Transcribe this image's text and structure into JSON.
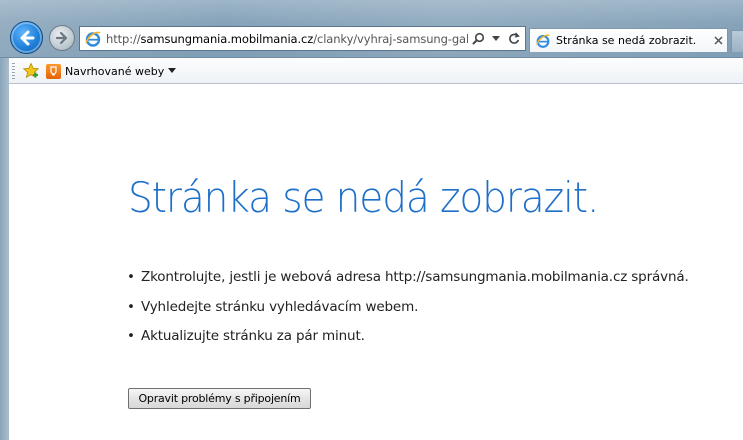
{
  "browser": {
    "address_url_prefix": "http://",
    "address_url_domain": "samsungmania.mobilmania.cz",
    "address_url_path": "/clanky/vyhraj-samsung-galaxy",
    "tab_title": "Stránka se nedá zobrazit.",
    "favorites": {
      "suggested_sites_label": "Navrhované weby"
    }
  },
  "error_page": {
    "title": "Stránka se nedá zobrazit.",
    "bullets": [
      "Zkontrolujte, jestli je webová adresa http://samsungmania.mobilmania.cz správná.",
      "Vyhledejte stránku vyhledávacím webem.",
      "Aktualizujte stránku za pár minut."
    ],
    "bullet_glyph": "•",
    "fix_button_label": "Opravit problémy s připojením"
  },
  "colors": {
    "title_blue": "#1e6fc8",
    "back_button_blue": "#1f7fd8"
  },
  "icons": {
    "back": "arrow-left-icon",
    "forward": "arrow-right-icon",
    "page": "ie-page-icon",
    "search": "search-icon",
    "dropdown": "chevron-down-icon",
    "refresh": "refresh-icon",
    "close": "close-icon",
    "favorites": "add-favorites-star-icon",
    "suggested": "suggested-sites-icon"
  }
}
